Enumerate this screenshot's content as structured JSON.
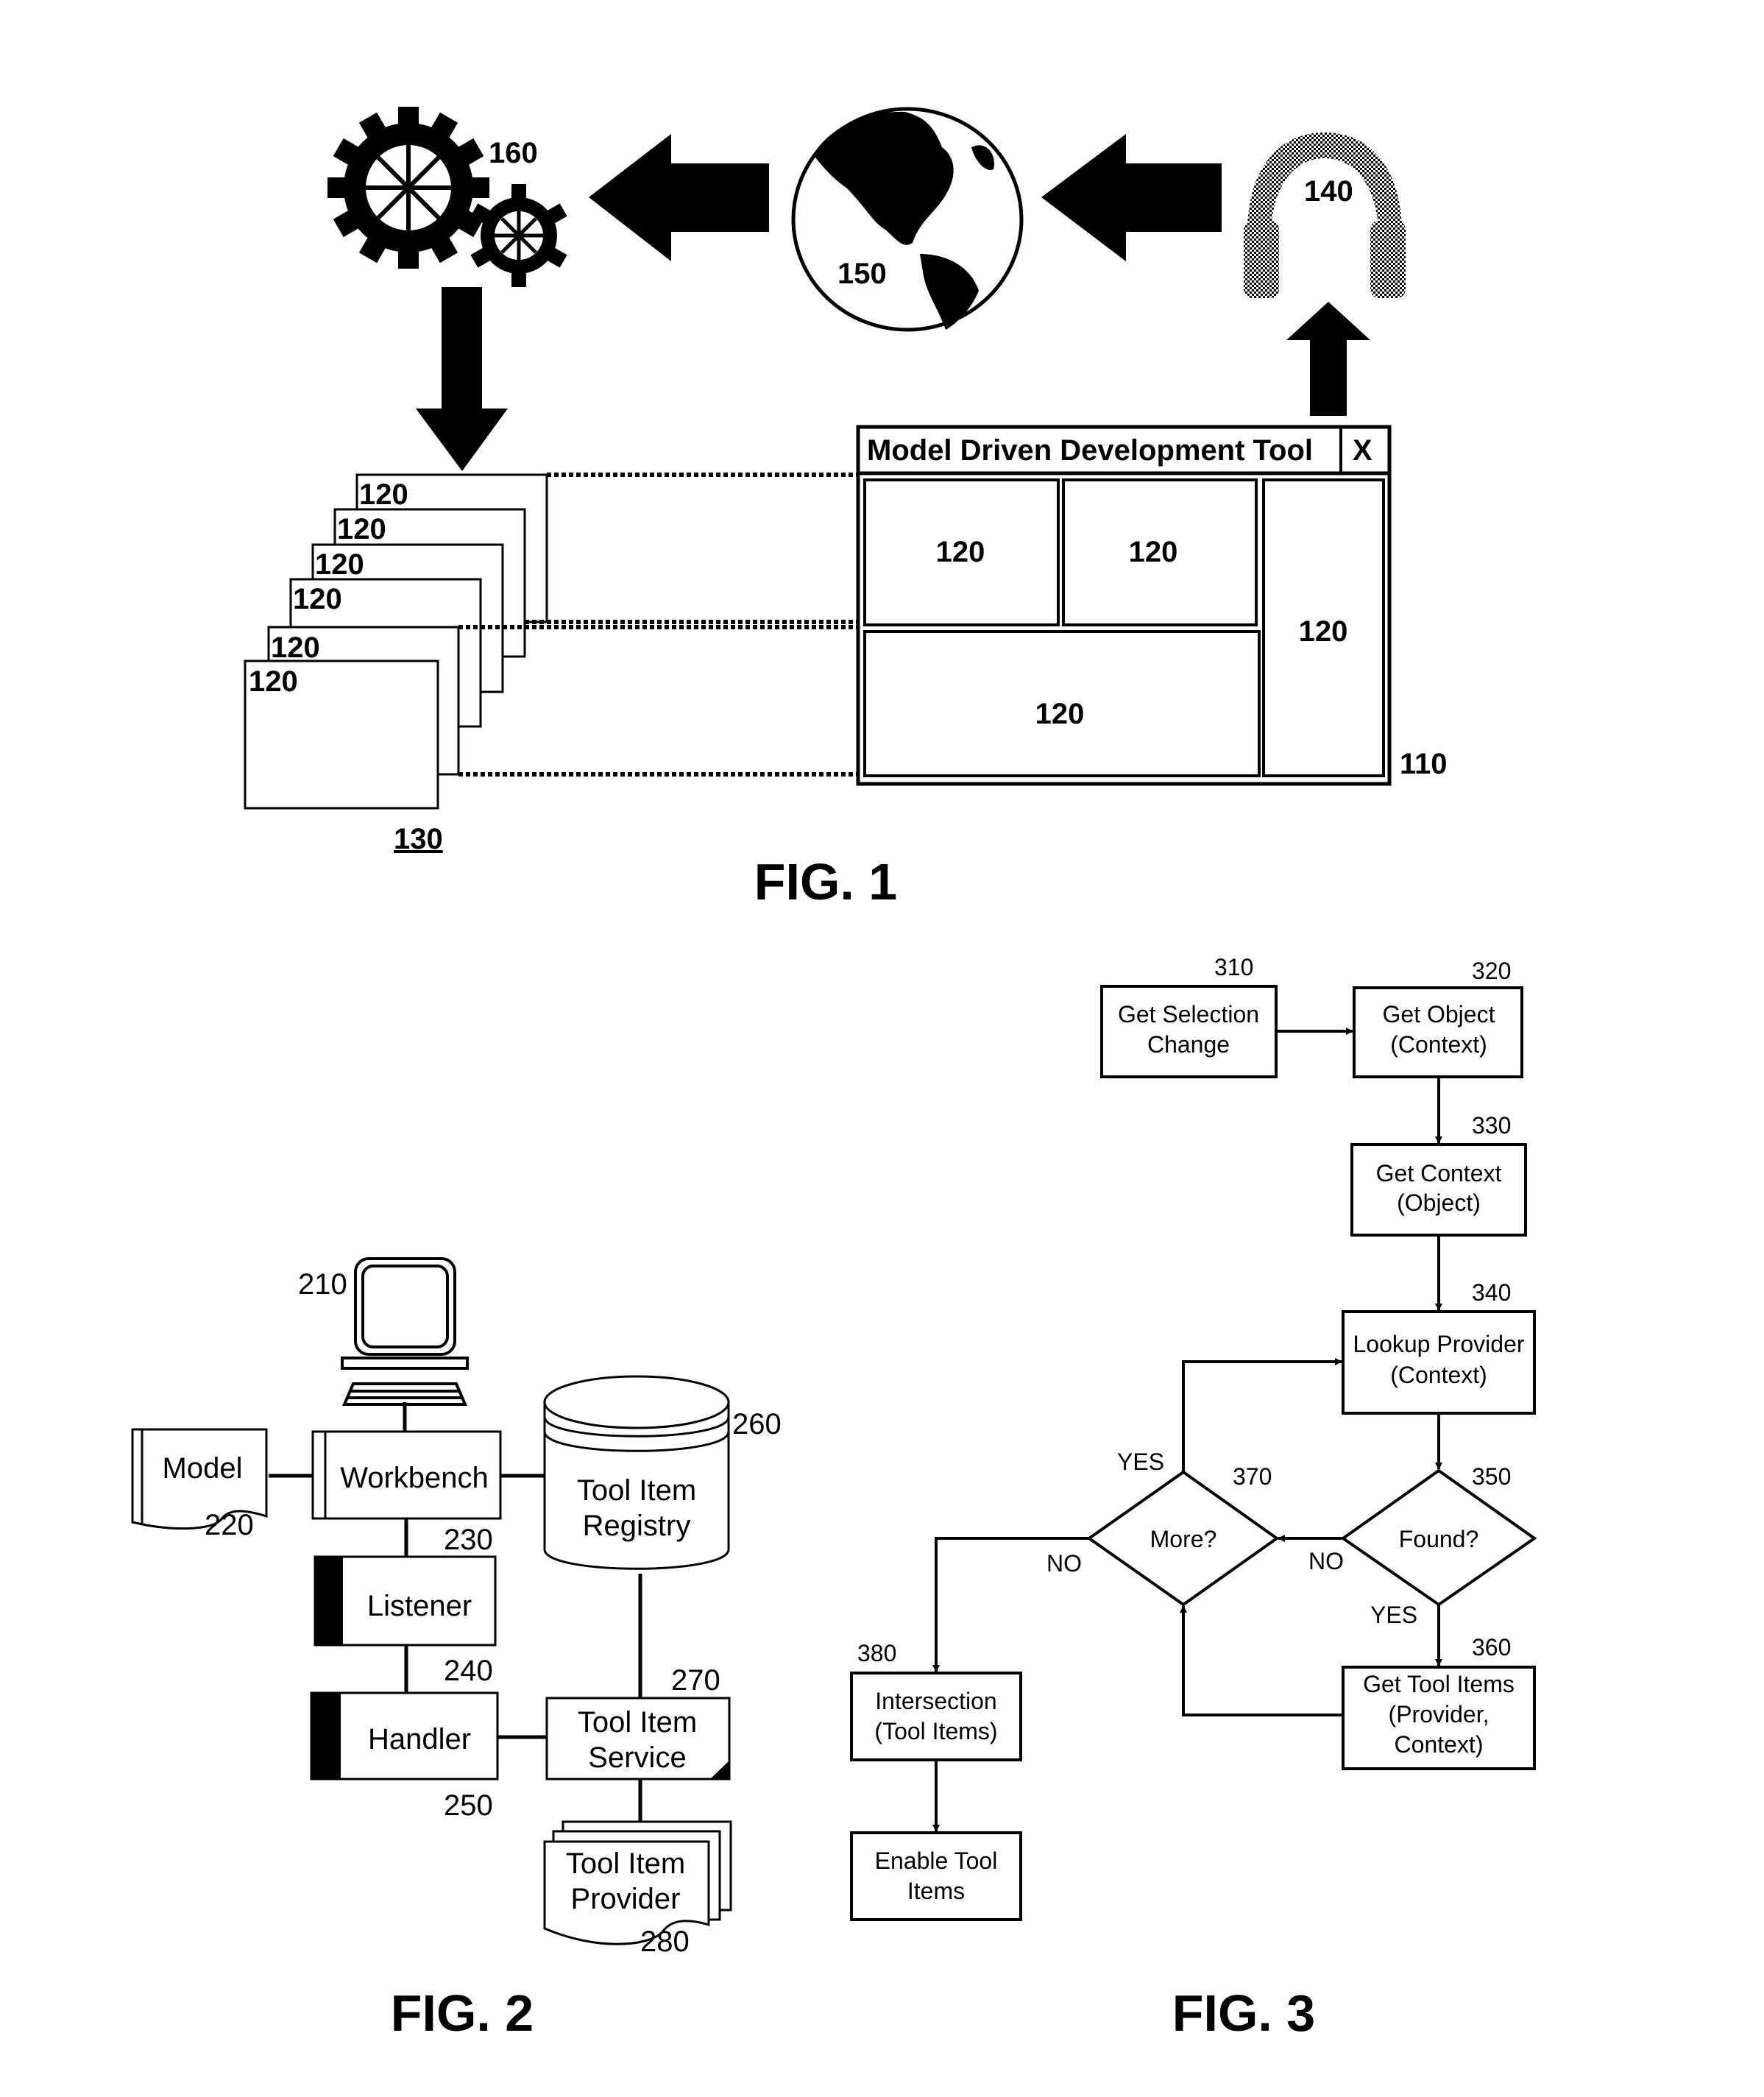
{
  "fig1": {
    "caption": "FIG. 1",
    "window_title": "Model Driven Development Tool",
    "close_label": "X",
    "window_ref": "110",
    "panel_ref": "120",
    "stack_ref": "130",
    "headphones_ref": "140",
    "globe_ref": "150",
    "gears_ref": "160"
  },
  "fig2": {
    "caption": "FIG. 2",
    "computer_ref": "210",
    "model": {
      "label": "Model",
      "ref": "220"
    },
    "workbench": {
      "label": "Workbench",
      "ref": "230"
    },
    "listener": {
      "label": "Listener",
      "ref": "240"
    },
    "handler": {
      "label": "Handler",
      "ref": "250"
    },
    "registry": {
      "line1": "Tool Item",
      "line2": "Registry",
      "ref": "260"
    },
    "service": {
      "line1": "Tool Item",
      "line2": "Service",
      "ref": "270"
    },
    "provider": {
      "line1": "Tool Item",
      "line2": "Provider",
      "ref": "280"
    }
  },
  "fig3": {
    "caption": "FIG. 3",
    "s310": {
      "line1": "Get Selection",
      "line2": "Change",
      "ref": "310"
    },
    "s320": {
      "line1": "Get Object",
      "line2": "(Context)",
      "ref": "320"
    },
    "s330": {
      "line1": "Get Context",
      "line2": "(Object)",
      "ref": "330"
    },
    "s340": {
      "line1": "Lookup Provider",
      "line2": "(Context)",
      "ref": "340"
    },
    "s350": {
      "label": "Found?",
      "ref": "350"
    },
    "s360": {
      "line1": "Get Tool Items",
      "line2": "(Provider,",
      "line3": "Context)",
      "ref": "360"
    },
    "s370": {
      "label": "More?",
      "ref": "370"
    },
    "s380": {
      "line1": "Intersection",
      "line2": "(Tool Items)",
      "ref": "380"
    },
    "s390": {
      "line1": "Enable Tool",
      "line2": "Items"
    },
    "yes": "YES",
    "no": "NO"
  }
}
